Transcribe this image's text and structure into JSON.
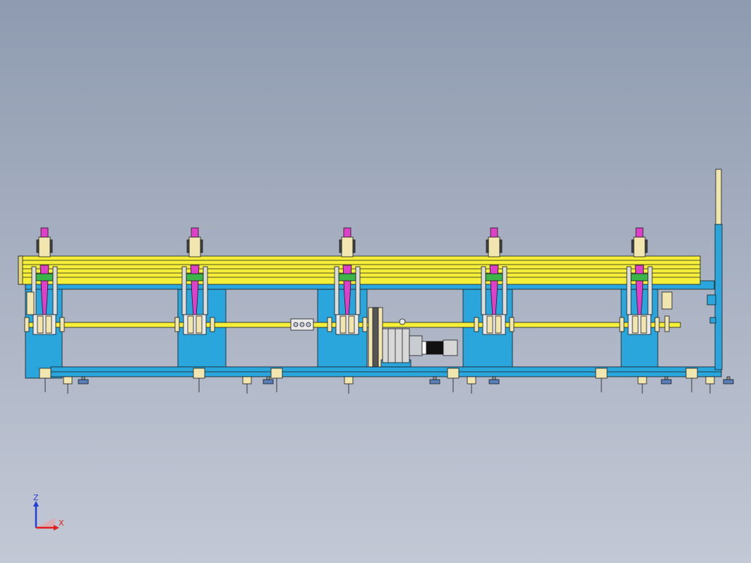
{
  "viewport": {
    "view": "front",
    "background_top": "#8e9bb0",
    "background_bottom": "#c3c8d5"
  },
  "colors": {
    "frame_blue": "#2aa6dc",
    "conveyor_yellow": "#f5ef3a",
    "guide_pink": "#e040c8",
    "cream": "#f1e6b0",
    "motor_gray": "#c9ccd1",
    "green_bracket": "#3bb54a"
  },
  "machine": {
    "stations_count": 5,
    "components": [
      "base-frame",
      "upper-rail",
      "conveyor-bars",
      "drive-shaft",
      "gear-motor",
      "coupling",
      "right-column",
      "feet"
    ]
  },
  "triad": {
    "z_label": "Z",
    "x_label": "X",
    "z_color": "#1f3fd8",
    "x_color": "#e02020"
  }
}
